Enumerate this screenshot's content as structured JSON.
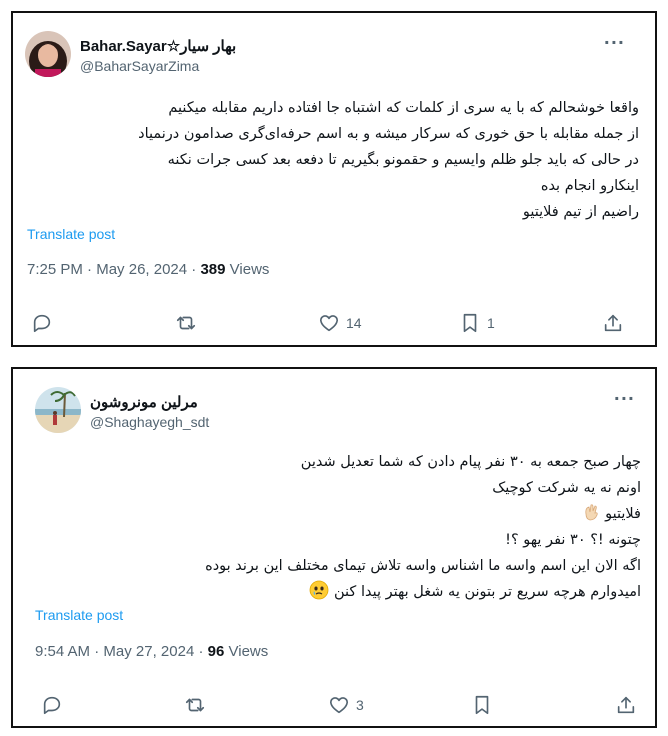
{
  "tweets": [
    {
      "display_name": "Bahar.Sayar☆بهار سیار",
      "handle": "@BaharSayarZima",
      "more_label": "···",
      "lines": [
        "واقعا خوشحالم که با یه سری از کلمات که اشتباه جا افتاده داریم مقابله میکنیم",
        "از جمله مقابله با حق خوری که سرکار میشه و به اسم حرفه‌ای‌گری صدامون درنمیاد",
        "در حالی که باید جلو ظلم وایسیم و حقمونو بگیریم تا دفعه بعد کسی جرات نکنه",
        "اینکارو انجام بده",
        "راضیم از تیم فلایتیو"
      ],
      "translate_label": "Translate post",
      "time": "7:25 PM",
      "date": "May 26, 2024",
      "views_count": "389",
      "views_label": "Views",
      "reply_count": "",
      "repost_count": "",
      "like_count": "14",
      "bookmark_count": "1"
    },
    {
      "display_name": "مرلین مونروشون",
      "handle": "@Shaghayegh_sdt",
      "more_label": "···",
      "lines": [
        "چهار صبح جمعه به ۳۰ نفر پیام دادن که شما تعدیل شدین",
        "اونم نه یه شرکت کوچیک",
        "فلایتیو",
        "چتونه !؟ ۳۰ نفر یهو ؟!",
        "اگه الان این اسم واسه ما اشناس واسه تلاش تیمای مختلف این برند بوده",
        "امیدوارم هرچه سریع تر بتونن یه شغل بهتر پیدا کنن"
      ],
      "translate_label": "Translate post",
      "time": "9:54 AM",
      "date": "May 27, 2024",
      "views_count": "96",
      "views_label": "Views",
      "reply_count": "",
      "repost_count": "",
      "like_count": "3",
      "bookmark_count": ""
    }
  ],
  "colors": {
    "text": "#0f1419",
    "secondary": "#536471",
    "link": "#1d9bf0",
    "border": "#111111"
  },
  "icons": {
    "reply": "speech-bubble-icon",
    "repost": "repost-arrows-icon",
    "like": "heart-icon",
    "bookmark": "bookmark-icon",
    "share": "share-upload-icon",
    "more": "more-dots-icon",
    "emoji_hand": "waving-hand-emoji",
    "emoji_face": "holding-back-tears-emoji"
  }
}
